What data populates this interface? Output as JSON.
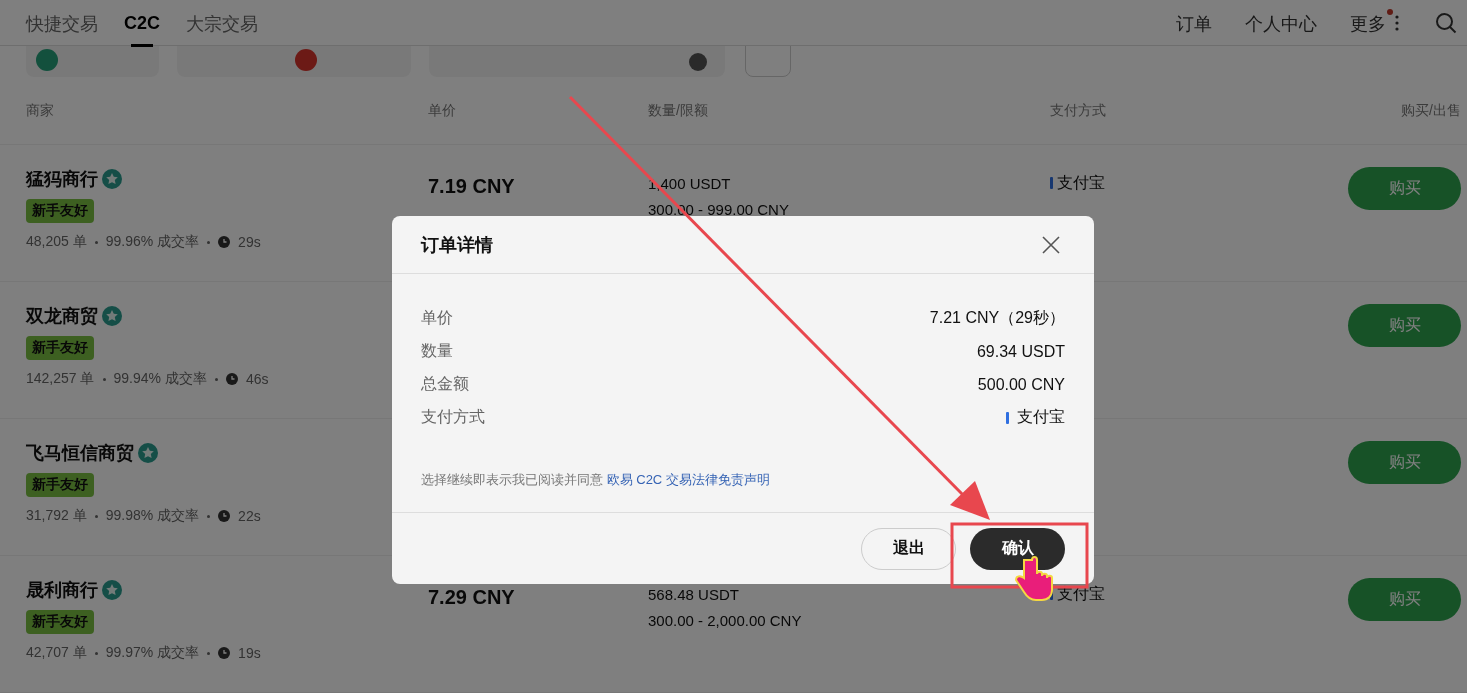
{
  "tabs": [
    {
      "label": "快捷交易",
      "selected": false
    },
    {
      "label": "C2C",
      "selected": true
    },
    {
      "label": "大宗交易",
      "selected": false
    }
  ],
  "nav_links": [
    {
      "label": "订单",
      "badge": false
    },
    {
      "label": "个人中心",
      "badge": false
    },
    {
      "label": "更多",
      "badge": true
    }
  ],
  "table": {
    "columns": [
      "商家",
      "单价",
      "数量/限额",
      "支付方式",
      "购买/出售"
    ],
    "rows": [
      {
        "merchant": "猛犸商行",
        "tag": "新手友好",
        "orders": "48,205 单",
        "rate": "99.96% 成交率",
        "time": "29s",
        "price": "7.19 CNY",
        "quantity": "1,400 USDT",
        "limit": "300.00 - 999.00 CNY",
        "payment": "支付宝",
        "action": "购买"
      },
      {
        "merchant": "双龙商贸",
        "tag": "新手友好",
        "orders": "142,257 单",
        "rate": "99.94% 成交率",
        "time": "46s",
        "action": "购买"
      },
      {
        "merchant": "飞马恒信商贸",
        "tag": "新手友好",
        "orders": "31,792 单",
        "rate": "99.98% 成交率",
        "time": "22s",
        "action": "购买"
      },
      {
        "merchant": "晟利商行",
        "tag": "新手友好",
        "orders": "42,707 单",
        "rate": "99.97% 成交率",
        "time": "19s",
        "price": "7.29 CNY",
        "quantity": "568.48 USDT",
        "limit": "300.00 - 2,000.00 CNY",
        "payment": "支付宝",
        "action": "购买"
      }
    ]
  },
  "modal": {
    "title": "订单详情",
    "details": [
      {
        "label": "单价",
        "value": "7.21 CNY（29秒）",
        "kind": "text"
      },
      {
        "label": "数量",
        "value": "69.34 USDT",
        "kind": "text"
      },
      {
        "label": "总金额",
        "value": "500.00 CNY",
        "kind": "text"
      },
      {
        "label": "支付方式",
        "value": "支付宝",
        "kind": "payment"
      }
    ],
    "disclaimer": "选择继续即表示我已阅读并同意",
    "disclaimer_link": "欧易 C2C 交易法律免责声明",
    "buttons": [
      {
        "label": "退出",
        "kind": "secondary"
      },
      {
        "label": "确认",
        "kind": "primary"
      }
    ]
  }
}
